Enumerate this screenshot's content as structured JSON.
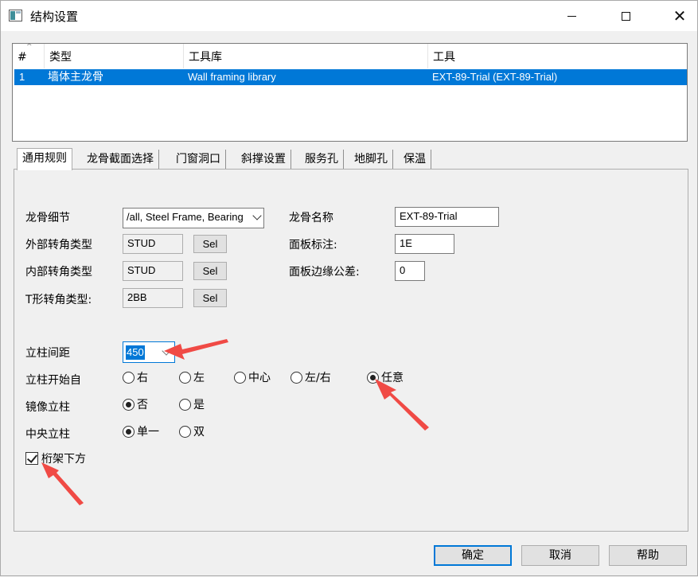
{
  "window": {
    "title": "结构设置"
  },
  "table": {
    "sort_indicator": "^",
    "columns": [
      "#",
      "类型",
      "工具库",
      "工具"
    ],
    "rows": [
      {
        "index": "1",
        "type": "墙体主龙骨",
        "library": "Wall framing library",
        "tool": "EXT-89-Trial (EXT-89-Trial)"
      }
    ]
  },
  "tabs": [
    "通用规则",
    "龙骨截面选择",
    "门窗洞口",
    "斜撑设置",
    "服务孔",
    "地脚孔",
    "保温"
  ],
  "form": {
    "stud_detail": {
      "label": "龙骨细节",
      "value": "/all, Steel Frame, Bearing"
    },
    "stud_name": {
      "label": "龙骨名称",
      "value": "EXT-89-Trial"
    },
    "outer_corner": {
      "label": "外部转角类型",
      "value": "STUD",
      "button": "Sel"
    },
    "panel_mark": {
      "label": "面板标注:",
      "value": "1E"
    },
    "inner_corner": {
      "label": "内部转角类型",
      "value": "STUD",
      "button": "Sel"
    },
    "panel_edge_tol": {
      "label": "面板边缘公差:",
      "value": "0"
    },
    "t_corner": {
      "label": "T形转角类型:",
      "value": "2BB",
      "button": "Sel"
    },
    "stud_spacing": {
      "label": "立柱间距",
      "value": "450"
    },
    "stud_start": {
      "label": "立柱开始自",
      "options": [
        "右",
        "左",
        "中心",
        "左/右",
        "任意"
      ],
      "selected": "任意"
    },
    "mirror_studs": {
      "label": "镜像立柱",
      "options": [
        "否",
        "是"
      ],
      "selected": "否"
    },
    "center_stud": {
      "label": "中央立柱",
      "options": [
        "单一",
        "双"
      ],
      "selected": "单一"
    },
    "under_truss": {
      "label": "桁架下方",
      "checked": true
    }
  },
  "buttons": {
    "ok": "确定",
    "cancel": "取消",
    "help": "帮助"
  },
  "colors": {
    "selection": "#0078d7",
    "annotation_arrow": "#f04a45"
  }
}
